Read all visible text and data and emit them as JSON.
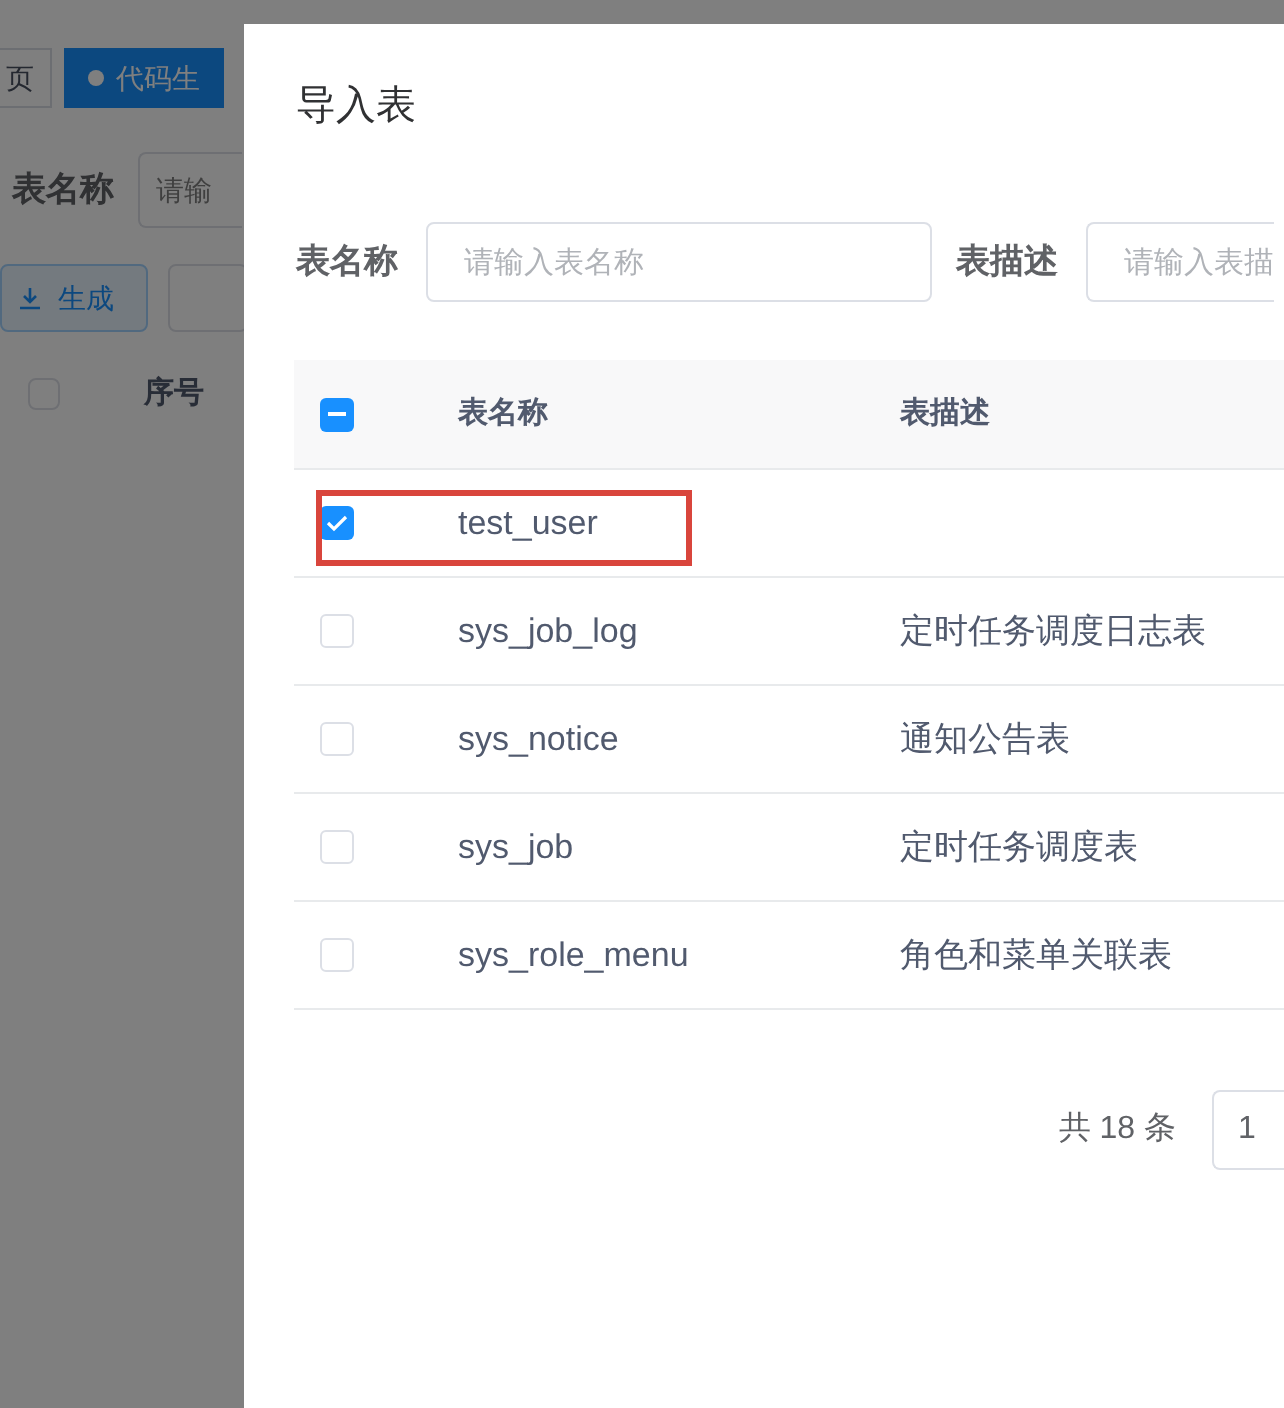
{
  "background_page": {
    "tabs": [
      {
        "label": "页",
        "selected": false
      },
      {
        "label": "代码生",
        "selected": true
      }
    ],
    "filter": {
      "label": "表名称",
      "placeholder": "请输"
    },
    "buttons": [
      {
        "label": "生成"
      }
    ],
    "table": {
      "header_checkbox": {
        "checked": false
      },
      "columns": [
        "序号"
      ]
    }
  },
  "dialog": {
    "title": "导入表",
    "filters": [
      {
        "label": "表名称",
        "placeholder": "请输入表名称"
      },
      {
        "label": "表描述",
        "placeholder": "请输入表描"
      }
    ],
    "table": {
      "header_checkbox": {
        "indeterminate": true
      },
      "columns": [
        "表名称",
        "表描述"
      ],
      "rows": [
        {
          "name": "test_user",
          "checked": true,
          "highlighted": true
        },
        {
          "name": "sys_job_log",
          "description": "定时任务调度日志表",
          "checked": false,
          "highlighted": false
        },
        {
          "name": "sys_notice",
          "description": "通知公告表",
          "checked": false,
          "highlighted": false
        },
        {
          "name": "sys_job",
          "description": "定时任务调度表",
          "checked": false,
          "highlighted": false
        },
        {
          "name": "sys_role_menu",
          "description": "角色和菜单关联表",
          "checked": false,
          "highlighted": false
        }
      ]
    },
    "pagination": {
      "total": "共 18 条",
      "page_size": "1"
    }
  }
}
